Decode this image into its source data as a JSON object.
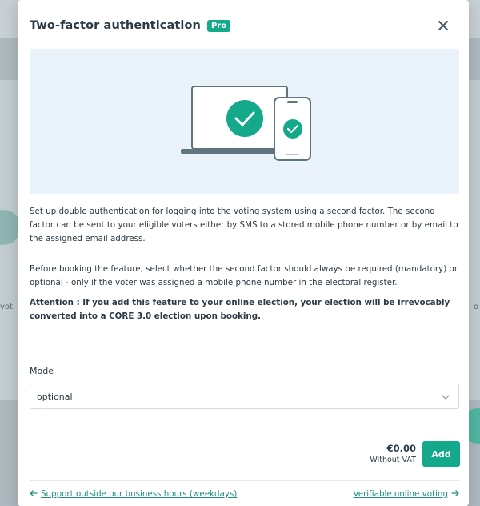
{
  "modal": {
    "title": "Two-factor authentication",
    "badge": "Pro",
    "close_icon": "close-icon"
  },
  "content": {
    "paragraph_1": "Set up double authentication for logging into the voting system using a second factor. The second factor can be sent to your eligible voters either by SMS to a stored mobile phone number or by email to the assigned email address.",
    "paragraph_2": "Before booking the feature, select whether the second factor should always be required (mandatory) or optional - only if the voter was assigned a mobile phone number in the electoral register.",
    "attention": "Attention : If you add this feature to your online election, your election will be irrevocably converted into a CORE 3.0 election upon booking."
  },
  "mode": {
    "label": "Mode",
    "selected": "optional"
  },
  "pricing": {
    "price": "€0.00",
    "vat_note": "Without VAT",
    "add_label": "Add"
  },
  "footer": {
    "left_link": "Support outside our business hours (weekdays)",
    "right_link": "Verifiable online voting"
  },
  "colors": {
    "accent": "#14a98b",
    "illustration_bg": "#eaf3fa",
    "device_stroke": "#5e7580"
  },
  "background": {
    "left_text": "voti",
    "right_text": "o"
  }
}
